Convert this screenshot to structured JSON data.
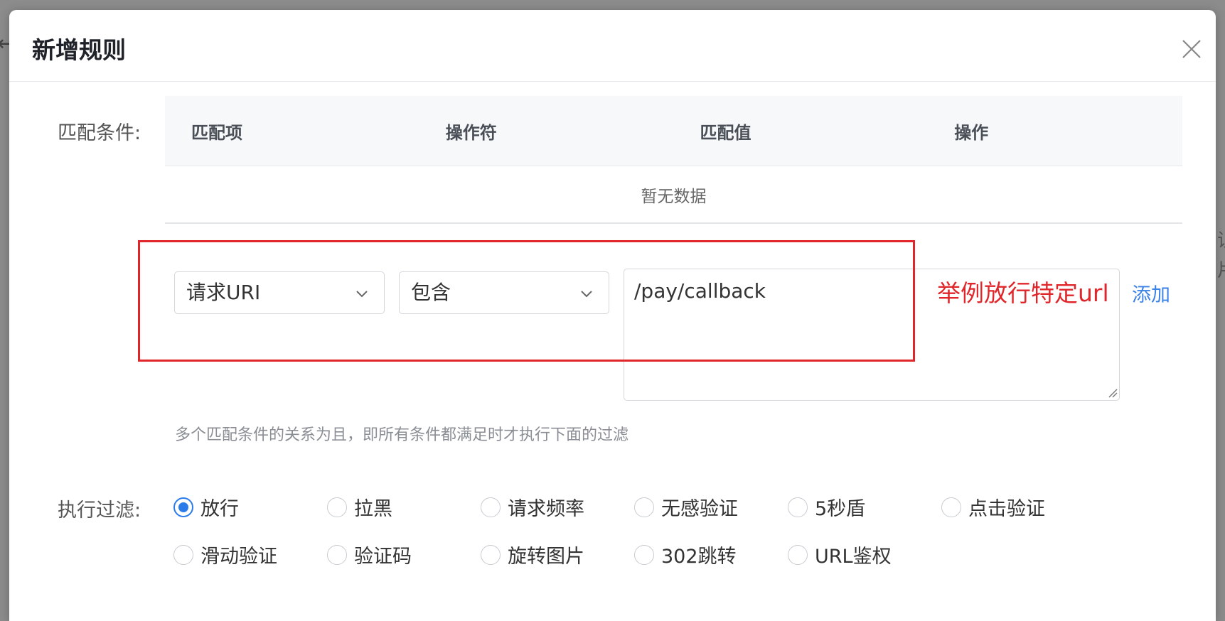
{
  "modal": {
    "title": "新增规则"
  },
  "conditions": {
    "label": "匹配条件:",
    "table": {
      "headers": [
        "匹配项",
        "操作符",
        "匹配值",
        "操作"
      ],
      "empty_text": "暂无数据"
    },
    "match_item": {
      "selected": "请求URI"
    },
    "operator": {
      "selected": "包含"
    },
    "match_value": {
      "value": "/pay/callback"
    },
    "add_label": "添加",
    "hint": "多个匹配条件的关系为且，即所有条件都满足时才执行下面的过滤"
  },
  "annotation": {
    "text": "举例放行特定url",
    "color": "#e0262a"
  },
  "filter": {
    "label": "执行过滤:",
    "options": [
      {
        "label": "放行",
        "checked": true
      },
      {
        "label": "拉黑",
        "checked": false
      },
      {
        "label": "请求频率",
        "checked": false
      },
      {
        "label": "无感验证",
        "checked": false
      },
      {
        "label": "5秒盾",
        "checked": false
      },
      {
        "label": "点击验证",
        "checked": false
      },
      {
        "label": "滑动验证",
        "checked": false
      },
      {
        "label": "验证码",
        "checked": false
      },
      {
        "label": "旋转图片",
        "checked": false
      },
      {
        "label": "302跳转",
        "checked": false
      },
      {
        "label": "URL鉴权",
        "checked": false
      }
    ]
  },
  "colors": {
    "primary": "#2b7ce9",
    "link": "#3b82e6",
    "annotation": "#e0262a"
  }
}
